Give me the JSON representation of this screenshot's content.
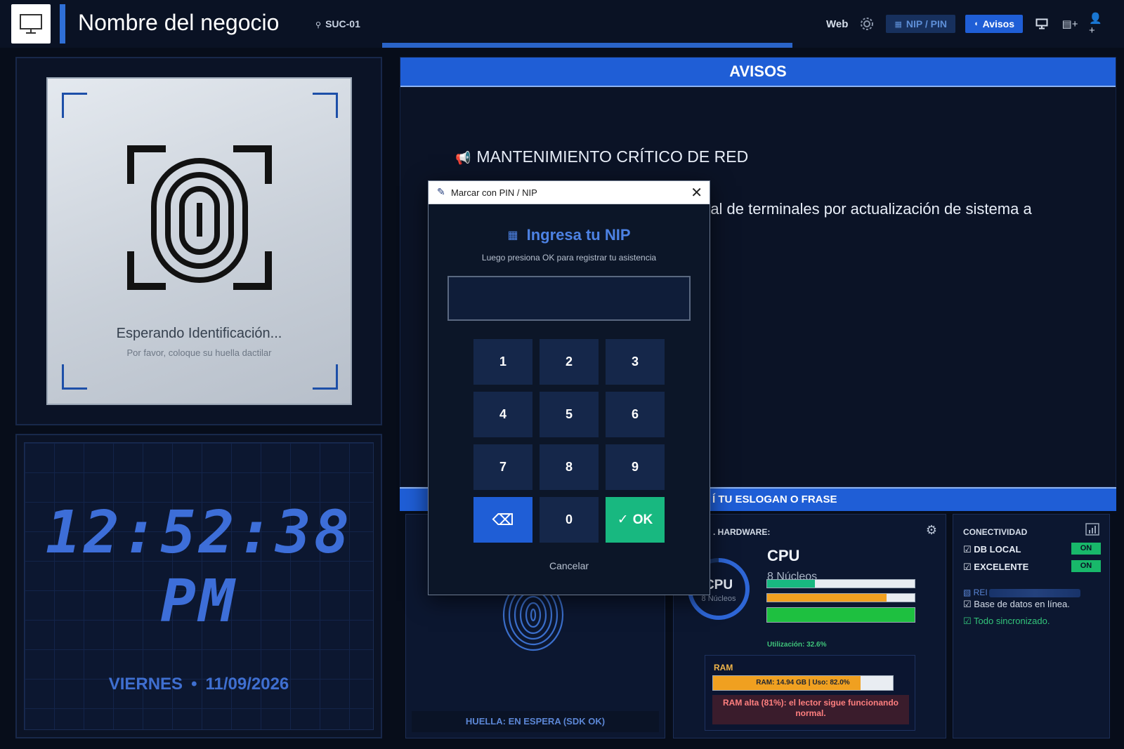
{
  "header": {
    "business_name": "Nombre del negocio",
    "branch": "SUC-01",
    "web_label": "Web",
    "nip_label": "NIP / PIN",
    "avisos_label": "Avisos"
  },
  "fingerprint_panel": {
    "waiting": "Esperando Identificación...",
    "hint": "Por favor, coloque su huella dactilar"
  },
  "clock": {
    "time": "12:52:38 PM",
    "weekday": "VIERNES",
    "separator": "•",
    "date": "11/09/2026"
  },
  "avisos": {
    "header": "AVISOS",
    "title": "MANTENIMIENTO CRÍTICO DE RED",
    "body_visible_fragment": "ral de terminales por actualización de sistema a"
  },
  "slogan": {
    "text": "Í TU ESLOGAN O FRASE"
  },
  "fingerprint_status": {
    "status": "HUELLA: EN ESPERA (SDK OK)"
  },
  "hardware": {
    "label": ". HARDWARE:",
    "ring_label": "CPU",
    "ring_sub": "8 Núcleos",
    "cpu_title": "CPU",
    "cpu_cores": "8 Núcleos",
    "bars": [
      {
        "fraction": 0.326,
        "color": "#18b880"
      },
      {
        "fraction": 0.81,
        "color": "#f0a020"
      },
      {
        "fraction": 1.0,
        "color": "#1ec040"
      }
    ],
    "utilization": "Utilización: 32.6%",
    "ram_title": "RAM",
    "ram_bar_text": "RAM: 14.94 GB | Uso: 82.0%",
    "ram_fraction": 0.82,
    "ram_alert": "RAM alta (81%): el lector sigue funcionando normal."
  },
  "connectivity": {
    "title": "CONECTIVIDAD",
    "rows": [
      {
        "label": "DB LOCAL",
        "state": "ON"
      },
      {
        "label": "EXCELENTE",
        "state": "ON"
      }
    ],
    "red_prefix": "REI",
    "note_db": "Base de datos en línea.",
    "note_sync": "Todo sincronizado."
  },
  "modal": {
    "window_title": "Marcar con PIN / NIP",
    "heading": "Ingresa tu NIP",
    "subtitle": "Luego presiona OK para registrar tu asistencia",
    "pin_value": "",
    "keys": [
      "1",
      "2",
      "3",
      "4",
      "5",
      "6",
      "7",
      "8",
      "9"
    ],
    "backspace": "⌫",
    "zero": "0",
    "ok": "OK",
    "cancel": "Cancelar"
  },
  "colors": {
    "accent": "#1f5ed6",
    "ok_green": "#18b880",
    "background": "#070d1a"
  }
}
